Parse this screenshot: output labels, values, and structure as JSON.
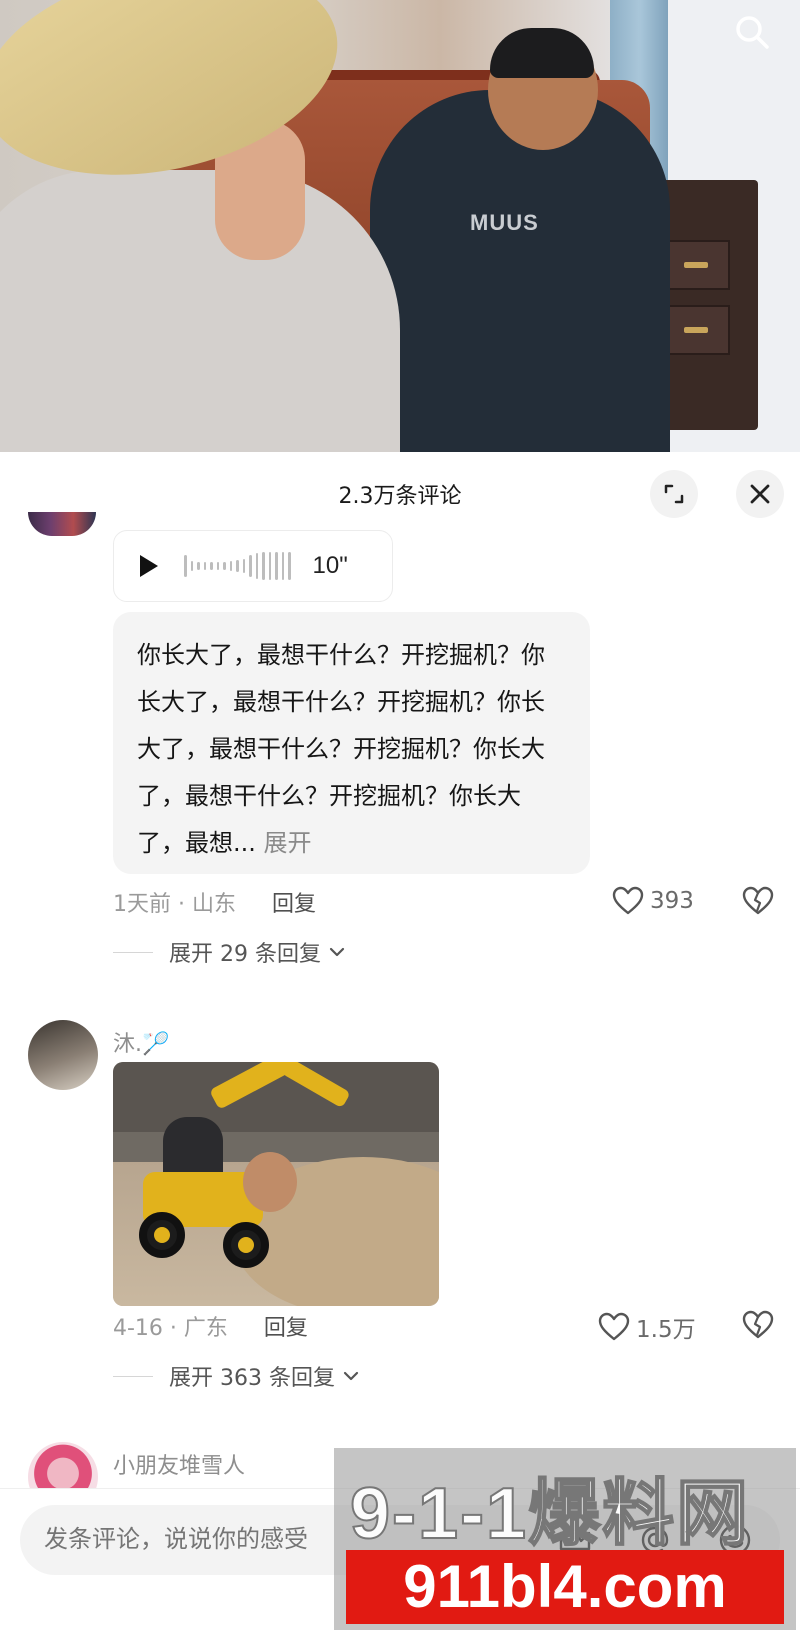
{
  "sheet": {
    "title": "2.3万条评论"
  },
  "comments": [
    {
      "voice_duration": "10\"",
      "text": "你长大了，最想干什么？开挖掘机？你长大了，最想干什么？开挖掘机？你长大了，最想干什么？开挖掘机？你长大了，最想干什么？开挖掘机？你长大了，最想...",
      "more_label": "展开",
      "time_location": "1天前 · 山东",
      "reply_label": "回复",
      "likes": "393",
      "expand_replies": "展开 29 条回复"
    },
    {
      "username": "沐.🏸",
      "time_location": "4-16 · 广东",
      "reply_label": "回复",
      "likes": "1.5万",
      "expand_replies": "展开 363 条回复"
    },
    {
      "username": "小朋友堆雪人"
    }
  ],
  "input": {
    "placeholder": "发条评论，说说你的感受"
  },
  "watermark": {
    "text": "9-1-1爆料网",
    "url": "911bl4.com"
  }
}
